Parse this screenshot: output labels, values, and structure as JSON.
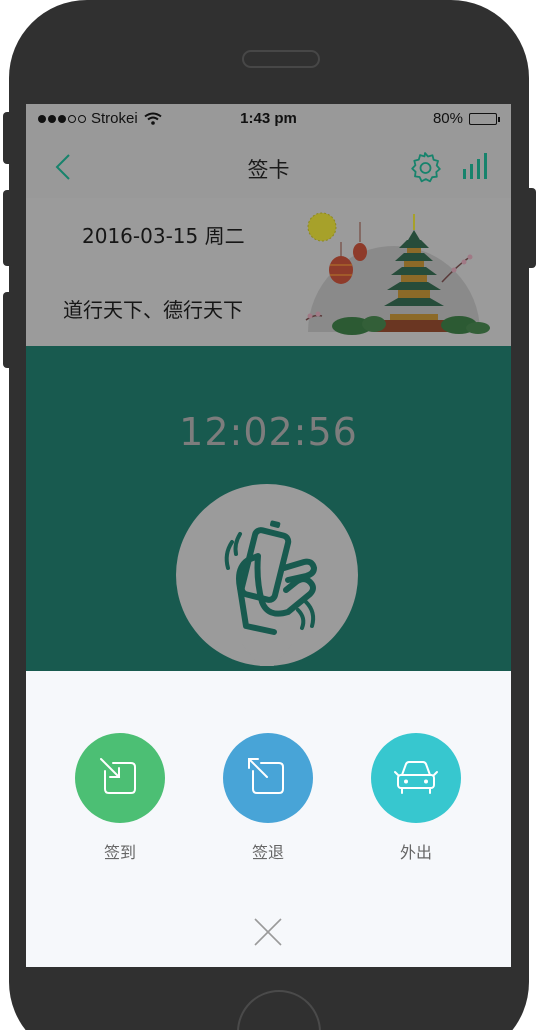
{
  "status_bar": {
    "carrier": "Strokei",
    "time": "1:43 pm",
    "battery": "80%",
    "battery_level": 0.8
  },
  "nav": {
    "title": "签卡",
    "icons": [
      "chevron-left-icon",
      "gear-icon",
      "bar-chart-icon"
    ],
    "accent_color": "#17836c"
  },
  "banner": {
    "date": "2016-03-15 周二",
    "motto": "道行天下、德行天下"
  },
  "punch": {
    "clock": "12:02:56",
    "icon": "phone-shake-icon"
  },
  "actions": [
    {
      "label": "签到",
      "icon": "check-in-icon",
      "color": "#4cbf74"
    },
    {
      "label": "签退",
      "icon": "check-out-icon",
      "color": "#48a4d7"
    },
    {
      "label": "外出",
      "icon": "car-icon",
      "color": "#37c7cf"
    }
  ],
  "colors": {
    "overlay_gray": "#999999",
    "punch_bg": "#185a4f",
    "sheet_bg": "#f6f8fb"
  }
}
